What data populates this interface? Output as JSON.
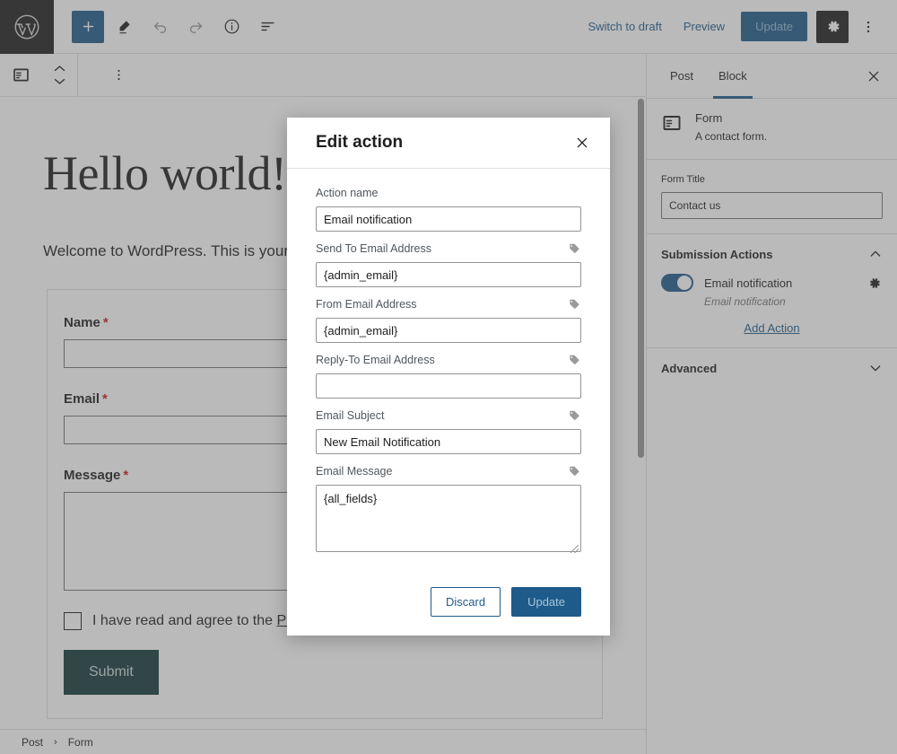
{
  "topbar": {
    "logo_icon": "wordpress-logo-icon",
    "add_block_icon": "plus-icon",
    "edit_icon": "pencil-icon",
    "undo_icon": "undo-arrow-icon",
    "redo_icon": "redo-arrow-icon",
    "details_icon": "info-circle-icon",
    "list_view_icon": "list-view-icon",
    "switch_to_draft_label": "Switch to draft",
    "preview_label": "Preview",
    "update_label": "Update",
    "settings_icon": "gear-icon",
    "options_icon": "kebab-menu-icon"
  },
  "block_toolbar": {
    "block_type_icon": "form-block-icon",
    "mover_icon": "up-down-chevron-icon",
    "more_options_icon": "kebab-menu-icon"
  },
  "canvas": {
    "post_title": "Hello world!",
    "post_paragraph": "Welcome to WordPress. This is your first post. Edit or delete it, then start writing!",
    "form": {
      "fields": [
        {
          "label": "Name",
          "required_marker": "*",
          "type": "text"
        },
        {
          "label": "Email",
          "required_marker": "*",
          "type": "text"
        },
        {
          "label": "Message",
          "required_marker": "*",
          "type": "textarea"
        }
      ],
      "consent_prefix": "I have read and agree to the ",
      "consent_link": "Privacy Policy",
      "consent_suffix": ".",
      "consent_required_marker": "*",
      "submit_label": "Submit"
    }
  },
  "breadcrumb": {
    "items": [
      "Post",
      "Form"
    ],
    "separator": "›"
  },
  "sidebar": {
    "tabs": [
      {
        "label": "Post",
        "active": false
      },
      {
        "label": "Block",
        "active": true
      }
    ],
    "close_icon": "close-icon",
    "block_card": {
      "icon": "form-block-icon",
      "title": "Form",
      "description": "A contact form."
    },
    "form_title_field": {
      "label": "Form Title",
      "value": "Contact us"
    },
    "submission_actions": {
      "title": "Submission Actions",
      "collapse_icon": "chevron-up-icon",
      "action": {
        "name": "Email notification",
        "subtitle": "Email notification",
        "enabled": true,
        "settings_icon": "gear-icon"
      },
      "add_action_label": "Add Action"
    },
    "advanced": {
      "title": "Advanced",
      "expand_icon": "chevron-down-icon"
    }
  },
  "modal": {
    "title": "Edit action",
    "close_icon": "close-icon",
    "tag_icon": "tag-icon",
    "fields": [
      {
        "label": "Action name",
        "value": "Email notification",
        "type": "input",
        "has_tag": false
      },
      {
        "label": "Send To Email Address",
        "value": "{admin_email}",
        "type": "input",
        "has_tag": true
      },
      {
        "label": "From Email Address",
        "value": "{admin_email}",
        "type": "input",
        "has_tag": true
      },
      {
        "label": "Reply-To Email Address",
        "value": "",
        "type": "input",
        "has_tag": true
      },
      {
        "label": "Email Subject",
        "value": "New Email Notification",
        "type": "input",
        "has_tag": true
      },
      {
        "label": "Email Message",
        "value": "{all_fields}",
        "type": "textarea",
        "has_tag": true
      }
    ],
    "discard_label": "Discard",
    "update_label": "Update"
  },
  "colors": {
    "accent_blue": "#1e5b8a",
    "dark": "#1e1e1e",
    "submit_green": "#12373a",
    "required_red": "#cc1818"
  }
}
